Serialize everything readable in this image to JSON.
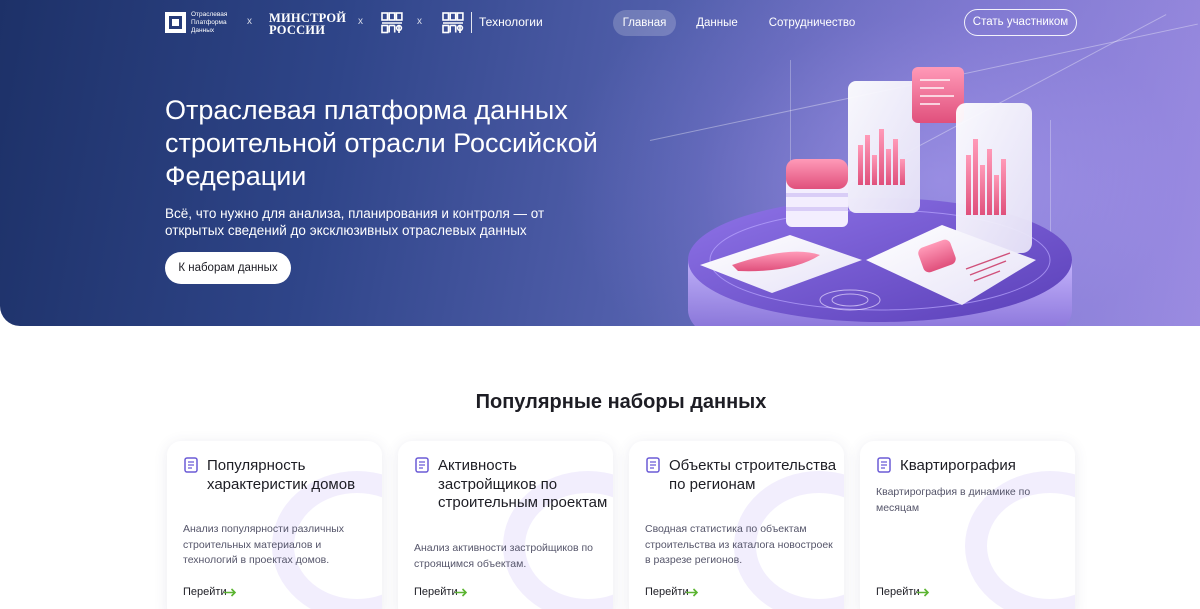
{
  "header": {
    "logo_text": "Отраслевая Платформа Данных",
    "sep_1": "x",
    "minstroy_line1": "МИНСТРОЙ",
    "minstroy_line2": "РОССИИ",
    "sep_2": "x",
    "sep_3": "x",
    "tech_label": "Технологии",
    "nav": [
      {
        "label": "Главная",
        "active": true
      },
      {
        "label": "Данные",
        "active": false
      },
      {
        "label": "Сотрудничество",
        "active": false
      }
    ],
    "cta_label": "Стать участником"
  },
  "hero": {
    "title": "Отраслевая платформа данных строительной отрасли Российской Федерации",
    "subtitle": "Всё, что нужно для анализа, планирования и контроля — от открытых сведений до эксклюзивных отраслевых данных",
    "button_label": "К наборам данных"
  },
  "section": {
    "title": "Популярные наборы данных"
  },
  "cards": [
    {
      "title": "Популярность характеристик домов",
      "desc": "Анализ популярности различных строительных материалов и технологий в проектах домов.",
      "link": "Перейти"
    },
    {
      "title": "Активность застройщиков по строительным проектам",
      "desc": "Анализ активности застройщиков по строящимся объектам.",
      "link": "Перейти"
    },
    {
      "title": "Объекты строительства по регионам",
      "desc": "Сводная статистика по объектам строительства из каталога новостроек в разрезе регионов.",
      "link": "Перейти"
    },
    {
      "title": "Квартирография",
      "desc": "Квартирография в динамике по месяцам",
      "link": "Перейти"
    }
  ],
  "colors": {
    "hero_dark": "#1d3168",
    "hero_light": "#9a8be0",
    "accent_icon": "#6b5bd6",
    "arrow_green": "#5bb431"
  },
  "icons": {
    "card_icon": "document-list-icon",
    "link_arrow": "arrow-right-icon"
  }
}
